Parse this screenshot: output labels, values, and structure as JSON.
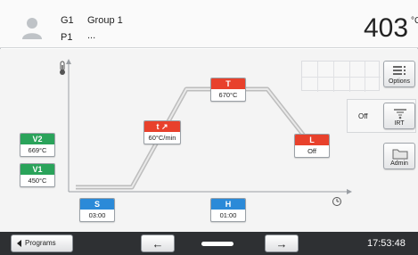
{
  "header": {
    "group_label": "G1",
    "group_name": "Group 1",
    "program_label": "P1",
    "program_name": "...",
    "temperature": "403",
    "temperature_unit": "°C"
  },
  "parameters": {
    "v2": {
      "label": "V2",
      "value": "669°C"
    },
    "v1": {
      "label": "V1",
      "value": "450°C"
    },
    "rate": {
      "label": "t ↗",
      "value": "60°C/min"
    },
    "hold_temp": {
      "label": "T",
      "value": "670°C"
    },
    "long_cool": {
      "label": "L",
      "value": "Off"
    },
    "closing_time": {
      "label": "S",
      "value": "03:00"
    },
    "hold_time": {
      "label": "H",
      "value": "01:00"
    }
  },
  "side_panel": {
    "options_label": "Options",
    "irt_label": "IRT",
    "irt_state": "Off",
    "admin_label": "Admin"
  },
  "bottom_bar": {
    "programs_label": "Programs",
    "back_glyph": "←",
    "forward_glyph": "→",
    "clock": "17:53:48"
  },
  "colors": {
    "header_bg": "#fafafa",
    "main_bg": "#f4f4f4",
    "bottom_bar_bg": "#2e3033",
    "green_badge": "#2aa35a",
    "red_badge": "#e8412c",
    "blue_badge": "#2b8ad8",
    "curve": "#bfbfbf"
  },
  "icons": {
    "user": "user-icon",
    "thermometer": "thermometer-icon",
    "clock": "clock-icon",
    "options": "list-icon",
    "irt": "irt-sensor-icon",
    "admin": "folder-icon"
  }
}
